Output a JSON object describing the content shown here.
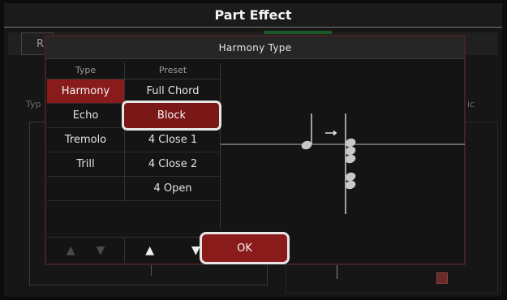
{
  "window": {
    "title": "Part Effect"
  },
  "background": {
    "tab_r": "R",
    "type_label": "Typ",
    "ic_label": "ic"
  },
  "dialog": {
    "title": "Harmony Type",
    "columns": {
      "type": "Type",
      "preset": "Preset"
    },
    "types": [
      "Harmony",
      "Echo",
      "Tremolo",
      "Trill"
    ],
    "presets": [
      "Full Chord",
      "Block",
      "4 Close 1",
      "4 Close 2",
      "4 Open"
    ],
    "selected_type": "Harmony",
    "selected_preset": "Block",
    "ok_label": "OK",
    "arrows": {
      "up": "▲",
      "down": "▼"
    }
  },
  "colors": {
    "accent": "#8a1b1b",
    "highlight_border": "#e6e6e6",
    "tab_green": "#1d5a2a"
  },
  "icons": [
    "up-arrow-icon",
    "down-arrow-icon",
    "arrow-right-icon"
  ]
}
